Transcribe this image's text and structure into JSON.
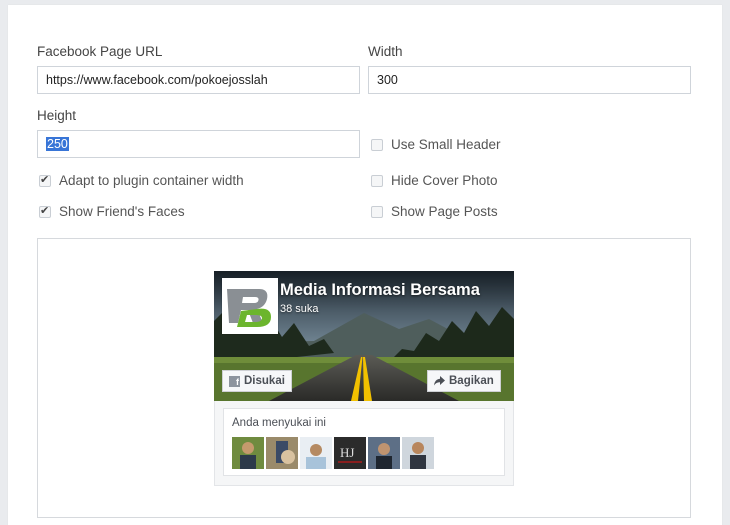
{
  "form": {
    "url_label": "Facebook Page URL",
    "url_value": "https://www.facebook.com/pokoejosslah",
    "width_label": "Width",
    "width_value": "300",
    "height_label": "Height",
    "height_value": "250",
    "options": [
      {
        "label": "Use Small Header",
        "checked": false
      },
      {
        "label": "Adapt to plugin container width",
        "checked": true
      },
      {
        "label": "Hide Cover Photo",
        "checked": false
      },
      {
        "label": "Show Friend's Faces",
        "checked": true
      },
      {
        "label": "Show Page Posts",
        "checked": false
      }
    ]
  },
  "preview": {
    "page_name": "Media Informasi Bersama",
    "likes": "38 suka",
    "logo_text": "RD",
    "like_button": "Disukai",
    "share_button": "Bagikan",
    "social_text": "Anda menyukai ini",
    "friend_count": 6
  },
  "colors": {
    "logo_green": "#6cb52d",
    "check_color": "#444444",
    "selection": "#3875d7"
  }
}
